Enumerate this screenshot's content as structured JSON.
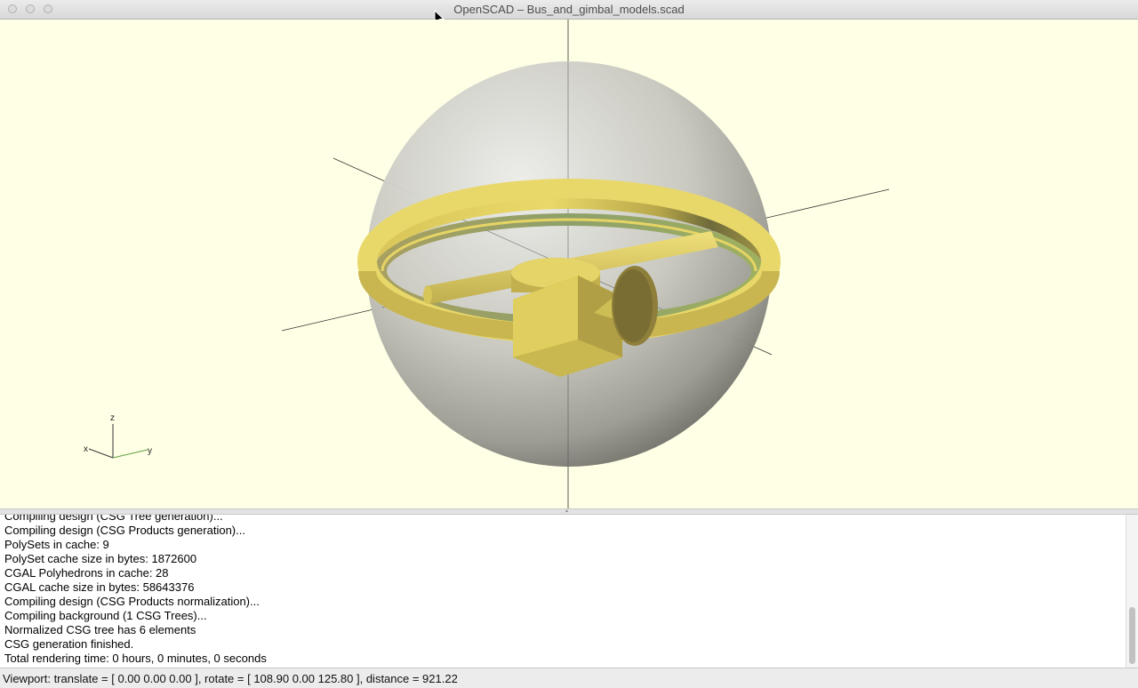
{
  "window": {
    "title": "OpenSCAD – Bus_and_gimbal_models.scad"
  },
  "viewport": {
    "background": "#ffffe5",
    "model_colors": {
      "sphere": "#c9c9bf",
      "ring": "#e0cc5a",
      "ring_inner": "#9fb060",
      "bus": "#d9c854"
    },
    "axes_indicator": {
      "x_label": "x",
      "y_label": "y",
      "z_label": "z"
    }
  },
  "console": {
    "lines": [
      "Compiling design (CSG Tree generation)...",
      "Compiling design (CSG Products generation)...",
      "PolySets in cache: 9",
      "PolySet cache size in bytes: 1872600",
      "CGAL Polyhedrons in cache: 28",
      "CGAL cache size in bytes: 58643376",
      "Compiling design (CSG Products normalization)...",
      "Compiling background (1 CSG Trees)...",
      "Normalized CSG tree has 6 elements",
      "CSG generation finished.",
      "Total rendering time: 0 hours, 0 minutes, 0 seconds"
    ]
  },
  "status": {
    "text": "Viewport: translate = [ 0.00 0.00 0.00 ], rotate = [ 108.90 0.00 125.80 ], distance = 921.22"
  }
}
